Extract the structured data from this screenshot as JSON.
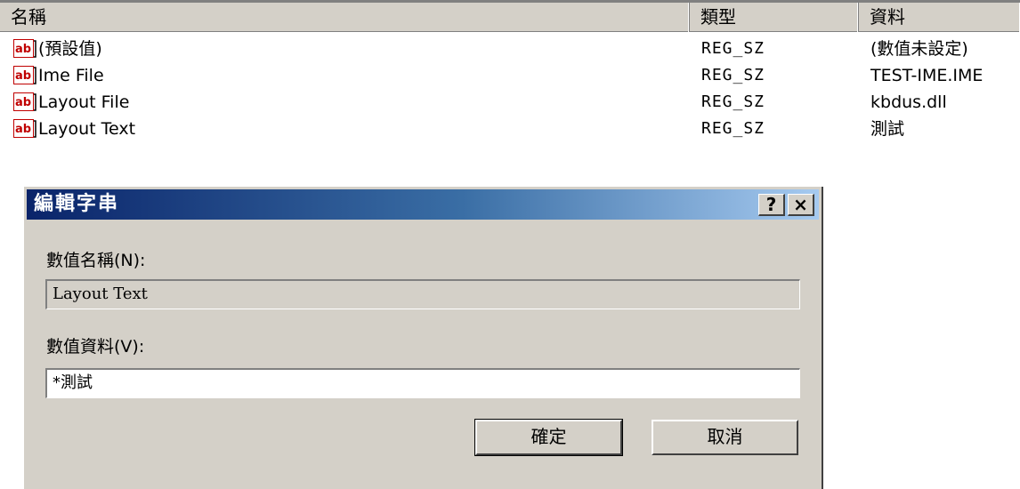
{
  "columns": {
    "name": "名稱",
    "type": "類型",
    "data": "資料"
  },
  "rows": [
    {
      "name": "(預設值)",
      "type": "REG_SZ",
      "data": "(數值未設定)",
      "icon": "reg-string-icon"
    },
    {
      "name": "Ime File",
      "type": "REG_SZ",
      "data": "TEST-IME.IME",
      "icon": "reg-string-icon"
    },
    {
      "name": "Layout File",
      "type": "REG_SZ",
      "data": "kbdus.dll",
      "icon": "reg-string-icon"
    },
    {
      "name": "Layout Text",
      "type": "REG_SZ",
      "data": "測試",
      "icon": "reg-string-icon"
    }
  ],
  "dialog": {
    "title": "編輯字串",
    "help_button": "?",
    "close_button": "×",
    "value_name_label": "數值名稱(N):",
    "value_name": "Layout Text",
    "value_data_label": "數值資料(V):",
    "value_data": "*測試",
    "ok_label": "確定",
    "cancel_label": "取消"
  },
  "colors": {
    "titlebar_start": "#0a246a",
    "titlebar_end": "#a6caf0",
    "chrome": "#d4d0c8",
    "icon_red": "#c00000"
  }
}
